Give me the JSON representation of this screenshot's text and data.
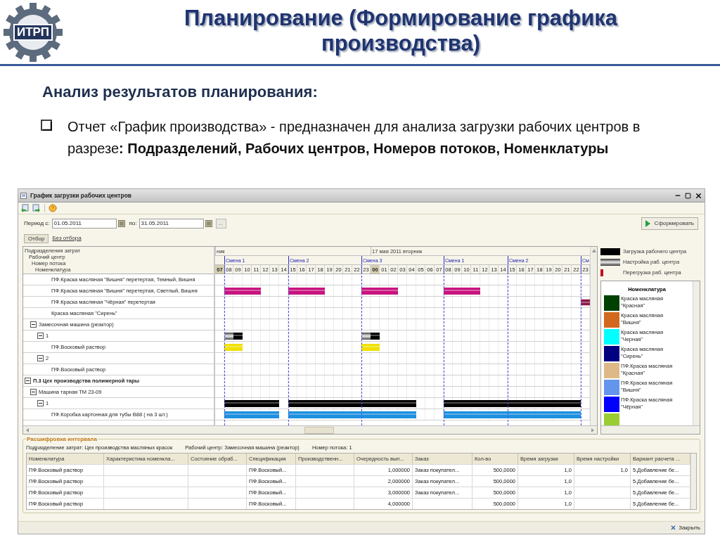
{
  "slide": {
    "logo_text": "ИТРП",
    "title": "Планирование (Формирование графика производства)",
    "subtitle": "Анализ результатов планирования:",
    "bullet": "Отчет «График производства» - предназначен для анализа загрузки рабочих центров в разрезе**: Подразделений, Рабочих центров, Номеров потоков, Номенклатуры**"
  },
  "window": {
    "title": "График загрузки рабочих центров",
    "period_label": "Период с:",
    "date_from": "01.05.2011",
    "to_label": "по:",
    "date_to": "31.05.2011",
    "more_button": "...",
    "generate_button": "Сформировать",
    "filter_button": "Отбор",
    "filter_link": "Без отбора"
  },
  "gantt": {
    "tree_headers": [
      "Подразделения затрат",
      "Рабочий центр",
      "Номер потока",
      "Номенклатура"
    ],
    "days": [
      {
        "label": "ник"
      },
      {
        "label": "17 мая 2011 вторник"
      }
    ],
    "shifts": [
      {
        "label": "Смена 1"
      },
      {
        "label": "Смена 2"
      },
      {
        "label": "Смена 3"
      },
      {
        "label": "Смена 1"
      },
      {
        "label": "Смена 2"
      },
      {
        "label": "См"
      }
    ],
    "hours": [
      {
        "label": "07",
        "shift_start": false,
        "day_start": true
      },
      {
        "label": "08",
        "shift_start": true,
        "day_start": false
      },
      {
        "label": "09",
        "shift_start": false,
        "day_start": false
      },
      {
        "label": "10",
        "shift_start": false,
        "day_start": false
      },
      {
        "label": "11",
        "shift_start": false,
        "day_start": false
      },
      {
        "label": "12",
        "shift_start": false,
        "day_start": false
      },
      {
        "label": "13",
        "shift_start": false,
        "day_start": false
      },
      {
        "label": "14",
        "shift_start": false,
        "day_start": false
      },
      {
        "label": "15",
        "shift_start": true,
        "day_start": false
      },
      {
        "label": "16",
        "shift_start": false,
        "day_start": false
      },
      {
        "label": "17",
        "shift_start": false,
        "day_start": false
      },
      {
        "label": "18",
        "shift_start": false,
        "day_start": false
      },
      {
        "label": "19",
        "shift_start": false,
        "day_start": false
      },
      {
        "label": "20",
        "shift_start": false,
        "day_start": false
      },
      {
        "label": "21",
        "shift_start": false,
        "day_start": false
      },
      {
        "label": "22",
        "shift_start": false,
        "day_start": false
      },
      {
        "label": "23",
        "shift_start": true,
        "day_start": false
      },
      {
        "label": "00",
        "shift_start": false,
        "day_start": true
      },
      {
        "label": "01",
        "shift_start": false,
        "day_start": false
      },
      {
        "label": "02",
        "shift_start": false,
        "day_start": false
      },
      {
        "label": "03",
        "shift_start": false,
        "day_start": false
      },
      {
        "label": "04",
        "shift_start": false,
        "day_start": false
      },
      {
        "label": "05",
        "shift_start": false,
        "day_start": false
      },
      {
        "label": "06",
        "shift_start": false,
        "day_start": false
      },
      {
        "label": "07",
        "shift_start": false,
        "day_start": false
      },
      {
        "label": "08",
        "shift_start": true,
        "day_start": false
      },
      {
        "label": "09",
        "shift_start": false,
        "day_start": false
      },
      {
        "label": "10",
        "shift_start": false,
        "day_start": false
      },
      {
        "label": "11",
        "shift_start": false,
        "day_start": false
      },
      {
        "label": "12",
        "shift_start": false,
        "day_start": false
      },
      {
        "label": "13",
        "shift_start": false,
        "day_start": false
      },
      {
        "label": "14",
        "shift_start": false,
        "day_start": false
      },
      {
        "label": "15",
        "shift_start": true,
        "day_start": false
      },
      {
        "label": "16",
        "shift_start": false,
        "day_start": false
      },
      {
        "label": "17",
        "shift_start": false,
        "day_start": false
      },
      {
        "label": "18",
        "shift_start": false,
        "day_start": false
      },
      {
        "label": "19",
        "shift_start": false,
        "day_start": false
      },
      {
        "label": "20",
        "shift_start": false,
        "day_start": false
      },
      {
        "label": "21",
        "shift_start": false,
        "day_start": false
      },
      {
        "label": "22",
        "shift_start": false,
        "day_start": false
      },
      {
        "label": "23",
        "shift_start": true,
        "day_start": false
      }
    ],
    "rows": [
      {
        "kind": "item",
        "label": "ПФ.Краска масляная \"Вишня\" перетертая, Темный, Вишня"
      },
      {
        "kind": "item",
        "label": "ПФ.Краска масляная \"Вишня\" перетертая, Светлый, Вишня",
        "color": "#c8147f",
        "cells": [
          {
            "kind": "empty"
          },
          {
            "kind": "load"
          },
          {
            "kind": "load"
          },
          {
            "kind": "load"
          },
          {
            "kind": "load"
          },
          {
            "kind": "empty"
          },
          {
            "kind": "empty"
          },
          {
            "kind": "empty"
          },
          {
            "kind": "load"
          },
          {
            "kind": "load"
          },
          {
            "kind": "load"
          },
          {
            "kind": "load"
          },
          {
            "kind": "empty"
          },
          {
            "kind": "empty"
          },
          {
            "kind": "empty"
          },
          {
            "kind": "empty"
          },
          {
            "kind": "load"
          },
          {
            "kind": "load"
          },
          {
            "kind": "load"
          },
          {
            "kind": "load"
          },
          {
            "kind": "empty"
          },
          {
            "kind": "empty"
          },
          {
            "kind": "empty"
          },
          {
            "kind": "empty"
          },
          {
            "kind": "empty"
          },
          {
            "kind": "load"
          },
          {
            "kind": "load"
          },
          {
            "kind": "load"
          },
          {
            "kind": "load"
          },
          {
            "kind": "empty"
          },
          {
            "kind": "empty"
          },
          {
            "kind": "empty"
          },
          {
            "kind": "empty"
          },
          {
            "kind": "empty"
          },
          {
            "kind": "empty"
          },
          {
            "kind": "empty"
          },
          {
            "kind": "empty"
          },
          {
            "kind": "empty"
          },
          {
            "kind": "empty"
          },
          {
            "kind": "empty"
          },
          {
            "kind": "empty"
          }
        ]
      },
      {
        "kind": "item",
        "label": "ПФ.Краска масляная \"Чёрная\" перетертая",
        "color": "#8b1a4a",
        "cells": [
          {
            "kind": "empty"
          },
          {
            "kind": "empty"
          },
          {
            "kind": "empty"
          },
          {
            "kind": "empty"
          },
          {
            "kind": "empty"
          },
          {
            "kind": "empty"
          },
          {
            "kind": "empty"
          },
          {
            "kind": "empty"
          },
          {
            "kind": "empty"
          },
          {
            "kind": "empty"
          },
          {
            "kind": "empty"
          },
          {
            "kind": "empty"
          },
          {
            "kind": "empty"
          },
          {
            "kind": "empty"
          },
          {
            "kind": "empty"
          },
          {
            "kind": "empty"
          },
          {
            "kind": "empty"
          },
          {
            "kind": "empty"
          },
          {
            "kind": "empty"
          },
          {
            "kind": "empty"
          },
          {
            "kind": "empty"
          },
          {
            "kind": "empty"
          },
          {
            "kind": "empty"
          },
          {
            "kind": "empty"
          },
          {
            "kind": "empty"
          },
          {
            "kind": "empty"
          },
          {
            "kind": "empty"
          },
          {
            "kind": "empty"
          },
          {
            "kind": "empty"
          },
          {
            "kind": "empty"
          },
          {
            "kind": "empty"
          },
          {
            "kind": "empty"
          },
          {
            "kind": "empty"
          },
          {
            "kind": "empty"
          },
          {
            "kind": "empty"
          },
          {
            "kind": "empty"
          },
          {
            "kind": "empty"
          },
          {
            "kind": "empty"
          },
          {
            "kind": "empty"
          },
          {
            "kind": "empty"
          },
          {
            "kind": "overload"
          }
        ]
      },
      {
        "kind": "item",
        "label": "Краска масляная \"Сирень\""
      },
      {
        "kind": "work_center",
        "label": "Замесочная машина (реактор)",
        "expanded": true,
        "children": [
          {
            "kind": "stream",
            "label": "1",
            "expanded": true,
            "color": "#000000",
            "cells": [
              {
                "kind": "empty"
              },
              {
                "kind": "setup"
              },
              {
                "kind": "load"
              },
              {
                "kind": "empty"
              },
              {
                "kind": "empty"
              },
              {
                "kind": "empty"
              },
              {
                "kind": "empty"
              },
              {
                "kind": "empty"
              },
              {
                "kind": "empty"
              },
              {
                "kind": "empty"
              },
              {
                "kind": "empty"
              },
              {
                "kind": "empty"
              },
              {
                "kind": "empty"
              },
              {
                "kind": "empty"
              },
              {
                "kind": "empty"
              },
              {
                "kind": "empty"
              },
              {
                "kind": "setup"
              },
              {
                "kind": "load"
              },
              {
                "kind": "empty"
              },
              {
                "kind": "empty"
              },
              {
                "kind": "empty"
              },
              {
                "kind": "empty"
              },
              {
                "kind": "empty"
              },
              {
                "kind": "empty"
              },
              {
                "kind": "empty"
              },
              {
                "kind": "empty"
              },
              {
                "kind": "empty"
              },
              {
                "kind": "empty"
              },
              {
                "kind": "empty"
              },
              {
                "kind": "empty"
              },
              {
                "kind": "empty"
              },
              {
                "kind": "empty"
              },
              {
                "kind": "empty"
              },
              {
                "kind": "empty"
              },
              {
                "kind": "empty"
              },
              {
                "kind": "empty"
              },
              {
                "kind": "empty"
              },
              {
                "kind": "empty"
              },
              {
                "kind": "empty"
              },
              {
                "kind": "empty"
              },
              {
                "kind": "empty"
              }
            ],
            "children": [
              {
                "kind": "item",
                "label": "ПФ.Восковый раствор",
                "color": "#f0e000",
                "cells": [
                  {
                    "kind": "empty"
                  },
                  {
                    "kind": "load"
                  },
                  {
                    "kind": "load"
                  },
                  {
                    "kind": "empty"
                  },
                  {
                    "kind": "empty"
                  },
                  {
                    "kind": "empty"
                  },
                  {
                    "kind": "empty"
                  },
                  {
                    "kind": "empty"
                  },
                  {
                    "kind": "empty"
                  },
                  {
                    "kind": "empty"
                  },
                  {
                    "kind": "empty"
                  },
                  {
                    "kind": "empty"
                  },
                  {
                    "kind": "empty"
                  },
                  {
                    "kind": "empty"
                  },
                  {
                    "kind": "empty"
                  },
                  {
                    "kind": "empty"
                  },
                  {
                    "kind": "load"
                  },
                  {
                    "kind": "load"
                  },
                  {
                    "kind": "empty"
                  },
                  {
                    "kind": "empty"
                  },
                  {
                    "kind": "empty"
                  },
                  {
                    "kind": "empty"
                  },
                  {
                    "kind": "empty"
                  },
                  {
                    "kind": "empty"
                  },
                  {
                    "kind": "empty"
                  },
                  {
                    "kind": "empty"
                  },
                  {
                    "kind": "empty"
                  },
                  {
                    "kind": "empty"
                  },
                  {
                    "kind": "empty"
                  },
                  {
                    "kind": "empty"
                  },
                  {
                    "kind": "empty"
                  },
                  {
                    "kind": "empty"
                  },
                  {
                    "kind": "empty"
                  },
                  {
                    "kind": "empty"
                  },
                  {
                    "kind": "empty"
                  },
                  {
                    "kind": "empty"
                  },
                  {
                    "kind": "empty"
                  },
                  {
                    "kind": "empty"
                  },
                  {
                    "kind": "empty"
                  },
                  {
                    "kind": "empty"
                  },
                  {
                    "kind": "empty"
                  }
                ]
              }
            ]
          },
          {
            "kind": "stream",
            "label": "2",
            "expanded": true,
            "children": [
              {
                "kind": "item",
                "label": "ПФ.Восковый раствор"
              }
            ]
          }
        ]
      },
      {
        "kind": "division",
        "label": "П.3 Цех производства полимерной тары",
        "expanded": true,
        "children": [
          {
            "kind": "work_center",
            "label": "Машина тарная ТМ 23-09",
            "expanded": true,
            "children": [
              {
                "kind": "stream",
                "label": "1",
                "expanded": true,
                "color": "#000000",
                "cells": [
                  {
                    "kind": "empty"
                  },
                  {
                    "kind": "load"
                  },
                  {
                    "kind": "load"
                  },
                  {
                    "kind": "load"
                  },
                  {
                    "kind": "load"
                  },
                  {
                    "kind": "load"
                  },
                  {
                    "kind": "load"
                  },
                  {
                    "kind": "empty"
                  },
                  {
                    "kind": "load"
                  },
                  {
                    "kind": "load"
                  },
                  {
                    "kind": "load"
                  },
                  {
                    "kind": "load"
                  },
                  {
                    "kind": "load"
                  },
                  {
                    "kind": "load"
                  },
                  {
                    "kind": "load"
                  },
                  {
                    "kind": "load"
                  },
                  {
                    "kind": "load"
                  },
                  {
                    "kind": "load"
                  },
                  {
                    "kind": "load"
                  },
                  {
                    "kind": "load"
                  },
                  {
                    "kind": "load"
                  },
                  {
                    "kind": "load"
                  },
                  {
                    "kind": "empty"
                  },
                  {
                    "kind": "empty"
                  },
                  {
                    "kind": "empty"
                  },
                  {
                    "kind": "load"
                  },
                  {
                    "kind": "load"
                  },
                  {
                    "kind": "load"
                  },
                  {
                    "kind": "load"
                  },
                  {
                    "kind": "load"
                  },
                  {
                    "kind": "load"
                  },
                  {
                    "kind": "load"
                  },
                  {
                    "kind": "load"
                  },
                  {
                    "kind": "load"
                  },
                  {
                    "kind": "load"
                  },
                  {
                    "kind": "load"
                  },
                  {
                    "kind": "load"
                  },
                  {
                    "kind": "load"
                  },
                  {
                    "kind": "load"
                  },
                  {
                    "kind": "load"
                  },
                  {
                    "kind": "empty"
                  }
                ],
                "children": [
                  {
                    "kind": "item",
                    "label": "ПФ.Коробка картонная для тубы В88 ( на 3 шт.)",
                    "color": "#1e90e0",
                    "cells": [
                      {
                        "kind": "empty"
                      },
                      {
                        "kind": "load"
                      },
                      {
                        "kind": "load"
                      },
                      {
                        "kind": "load"
                      },
                      {
                        "kind": "load"
                      },
                      {
                        "kind": "load"
                      },
                      {
                        "kind": "load"
                      },
                      {
                        "kind": "empty"
                      },
                      {
                        "kind": "load"
                      },
                      {
                        "kind": "load"
                      },
                      {
                        "kind": "load"
                      },
                      {
                        "kind": "load"
                      },
                      {
                        "kind": "load"
                      },
                      {
                        "kind": "load"
                      },
                      {
                        "kind": "load"
                      },
                      {
                        "kind": "load"
                      },
                      {
                        "kind": "load"
                      },
                      {
                        "kind": "load"
                      },
                      {
                        "kind": "load"
                      },
                      {
                        "kind": "load"
                      },
                      {
                        "kind": "load"
                      },
                      {
                        "kind": "load"
                      },
                      {
                        "kind": "empty"
                      },
                      {
                        "kind": "empty"
                      },
                      {
                        "kind": "empty"
                      },
                      {
                        "kind": "load"
                      },
                      {
                        "kind": "load"
                      },
                      {
                        "kind": "load"
                      },
                      {
                        "kind": "load"
                      },
                      {
                        "kind": "load"
                      },
                      {
                        "kind": "load"
                      },
                      {
                        "kind": "load"
                      },
                      {
                        "kind": "load"
                      },
                      {
                        "kind": "load"
                      },
                      {
                        "kind": "load"
                      },
                      {
                        "kind": "load"
                      },
                      {
                        "kind": "load"
                      },
                      {
                        "kind": "load"
                      },
                      {
                        "kind": "load"
                      },
                      {
                        "kind": "load"
                      },
                      {
                        "kind": "empty"
                      }
                    ]
                  }
                ]
              }
            ]
          }
        ]
      }
    ]
  },
  "legend": {
    "items": [
      {
        "kind": "load",
        "label": "Загрузка рабочего центра"
      },
      {
        "kind": "setup",
        "label": "Настройка раб. центра"
      },
      {
        "kind": "overload",
        "label": "Перегрузка раб. центра"
      }
    ],
    "nomenclature_title": "Номенклатура",
    "nomenclature": [
      {
        "label": "Краска масляная \"Красная\"",
        "color": "#004000"
      },
      {
        "label": "Краска масляная \"Вишня\"",
        "color": "#d2691e"
      },
      {
        "label": "Краска масляная \"Черная\"",
        "color": "#00ffff"
      },
      {
        "label": "Краска масляная \"Сирень\"",
        "color": "#000080"
      },
      {
        "label": "ПФ.Краска масляная \"Красная\"",
        "color": "#deb887"
      },
      {
        "label": "ПФ.Краска масляная \"Вишня\"",
        "color": "#6495ed"
      },
      {
        "label": "ПФ.Краска масляная \"Чёрная\"",
        "color": "#0000ff"
      },
      {
        "color": "#9acd32"
      }
    ]
  },
  "detail": {
    "title": "Расшифровка интервала",
    "info": [
      "Подразделение затрат: Цех производства масляных красок",
      "Рабочий центр: Замесочная машина (реактор)",
      "Номер потока: 1"
    ],
    "columns": [
      {
        "label": "Номенклатура"
      },
      {
        "label": "Характеристика номенкла..."
      },
      {
        "label": "Состояние обраб..."
      },
      {
        "label": "Спецификация"
      },
      {
        "label": "Производственн..."
      },
      {
        "label": "Очередность вып..."
      },
      {
        "label": "Заказ"
      },
      {
        "label": "Кол-во"
      },
      {
        "label": "Время загрузки"
      },
      {
        "label": "Время настройки"
      },
      {
        "label": "Вариант расчета ..."
      }
    ],
    "rows": [
      [
        "ПФ.Восковый раствор",
        "",
        "",
        "ПФ.Восковый...",
        "",
        "1,000000",
        "Заказ покупател...",
        "500,0000",
        "1,0",
        "1,0",
        "5.Добавление бе..."
      ],
      [
        "ПФ.Восковый раствор",
        "",
        "",
        "ПФ.Восковый...",
        "",
        "2,000000",
        "Заказ покупател...",
        "500,0000",
        "1,0",
        "",
        "5.Добавление бе..."
      ],
      [
        "ПФ.Восковый раствор",
        "",
        "",
        "ПФ.Восковый...",
        "",
        "3,000000",
        "Заказ покупател...",
        "500,0000",
        "1,0",
        "",
        "5.Добавление бе..."
      ],
      [
        "ПФ.Восковый раствор",
        "",
        "",
        "ПФ.Восковый...",
        "",
        "4,000000",
        "",
        "500,0000",
        "1,0",
        "",
        "5.Добавление бе..."
      ]
    ]
  },
  "close_button": "Закрыть"
}
